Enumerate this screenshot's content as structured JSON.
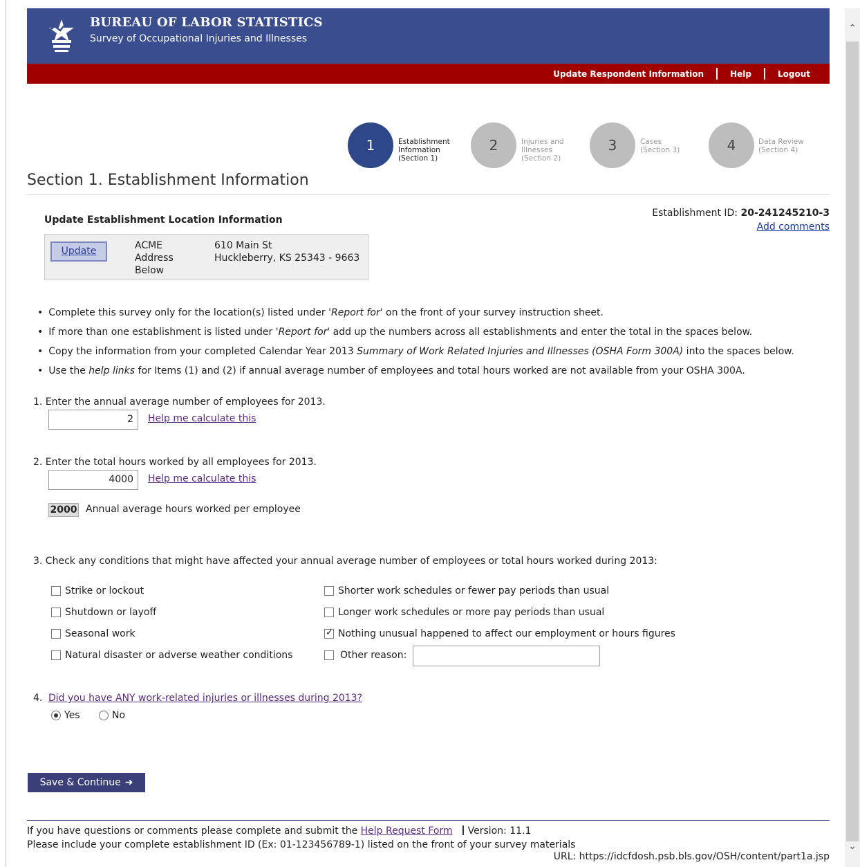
{
  "header": {
    "title": "BUREAU OF LABOR STATISTICS",
    "subtitle": "Survey of Occupational Injuries and Illnesses",
    "nav": [
      "Update Respondent Information",
      "Help",
      "Logout"
    ]
  },
  "steps": [
    {
      "num": "1",
      "label": "Establishment Information (Section 1)"
    },
    {
      "num": "2",
      "label": "Injuries and Illnesses (Section 2)"
    },
    {
      "num": "3",
      "label": "Cases (Section 3)"
    },
    {
      "num": "4",
      "label": "Data Review (Section 4)"
    }
  ],
  "section_title": "Section 1. Establishment Information",
  "location": {
    "heading": "Update Establishment Location Information",
    "update_label": "Update",
    "name": "ACME Address Below",
    "street": "610 Main St",
    "city_line": "Huckleberry,  KS  25343 - 9663"
  },
  "establishment": {
    "id_label": "Establishment ID:",
    "id_value": "20-241245210-3",
    "add_comments": "Add comments"
  },
  "bullets": {
    "b1_pre": "Complete this survey only for the location(s) listed under ",
    "b1_em": "'Report for'",
    "b1_post": " on the front of your survey instruction sheet.",
    "b2_pre": "If more than one establishment is listed under ",
    "b2_em": "'Report for'",
    "b2_post": " add up the numbers across all establishments and enter the total in the spaces below.",
    "b3_pre": "Copy the information from your completed Calendar Year 2013 ",
    "b3_em": "Summary of Work Related Injuries and Illnesses (OSHA Form 300A)",
    "b3_post": " into the spaces below.",
    "b4_pre": "Use the ",
    "b4_em": "help links",
    "b4_post": " for Items (1) and (2) if annual average number of employees and total hours worked are not available from your OSHA 300A."
  },
  "q1": {
    "text": "1.  Enter the annual average number of employees for 2013.",
    "value": "2",
    "help": "Help me calculate this"
  },
  "q2": {
    "text": "2.  Enter the total hours worked by all employees for 2013.",
    "value": "4000",
    "help": "Help me calculate this",
    "avg_value": "2000",
    "avg_label": "Annual average hours worked per employee"
  },
  "q3": {
    "text": "3.  Check any conditions that might have affected your annual average number of employees or total hours worked during 2013:",
    "left": [
      "Strike or lockout",
      "Shutdown or layoff",
      "Seasonal work",
      "Natural disaster or adverse weather conditions"
    ],
    "right": [
      "Shorter work schedules or fewer pay periods than usual",
      "Longer work schedules or more pay periods than usual",
      "Nothing unusual happened to affect our employment or hours figures",
      "Other reason:"
    ]
  },
  "q4": {
    "number": "4.",
    "link": "Did you have ANY work-related injuries or illnesses during 2013?",
    "yes": "Yes",
    "no": "No"
  },
  "save_label": "Save & Continue",
  "footer": {
    "line1_pre": "If you have questions or comments please complete and submit the ",
    "line1_link": "Help Request Form",
    "version": "Version: 11.1",
    "line2": "Please include your complete establishment ID (Ex: 01-123456789-1) listed on the front of your survey materials",
    "url": "URL: https://idcfdosh.psb.bls.gov/OSH/content/part1a.jsp"
  },
  "colors": {
    "header_blue": "#3a4d8f",
    "nav_red": "#a00000",
    "step_active": "#2e4788",
    "button": "#3a3f7a"
  }
}
